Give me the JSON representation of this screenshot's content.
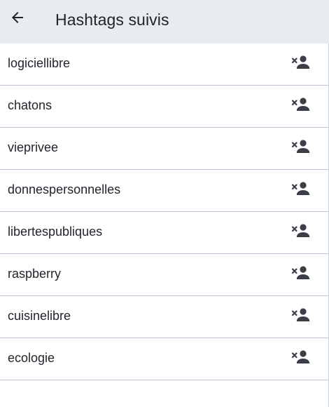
{
  "header": {
    "title": "Hashtags suivis",
    "back_icon": "arrow-left-icon"
  },
  "colors": {
    "appbar_bg": "#e8ebf0",
    "divider": "#b9c6d6",
    "text": "#1f232a",
    "icon": "#3a3f47"
  },
  "hashtags": [
    {
      "name": "logiciellibre",
      "action_icon": "person-remove-icon"
    },
    {
      "name": "chatons",
      "action_icon": "person-remove-icon"
    },
    {
      "name": "vieprivee",
      "action_icon": "person-remove-icon"
    },
    {
      "name": "donnespersonnelles",
      "action_icon": "person-remove-icon"
    },
    {
      "name": "libertespubliques",
      "action_icon": "person-remove-icon"
    },
    {
      "name": "raspberry",
      "action_icon": "person-remove-icon"
    },
    {
      "name": "cuisinelibre",
      "action_icon": "person-remove-icon"
    },
    {
      "name": "ecologie",
      "action_icon": "person-remove-icon"
    }
  ]
}
